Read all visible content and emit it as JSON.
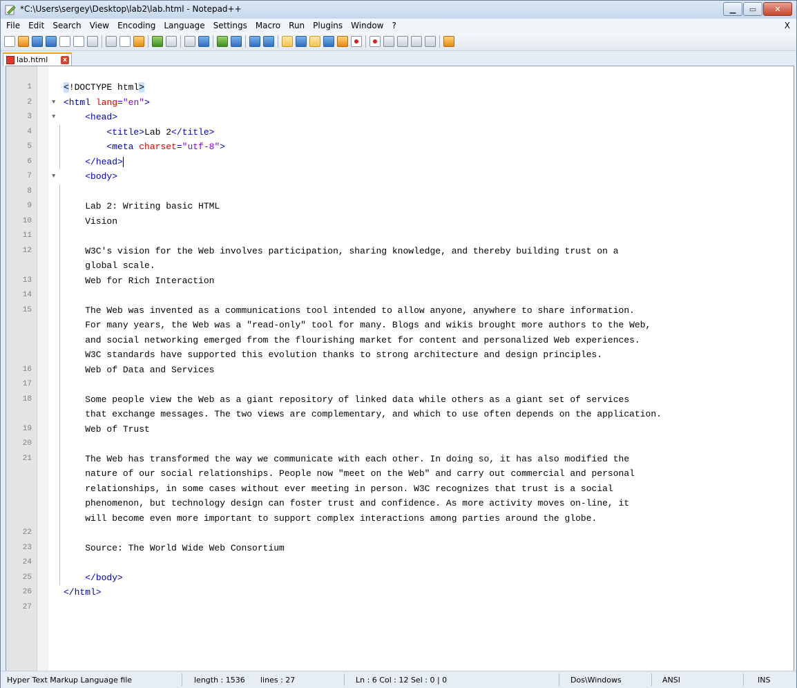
{
  "window": {
    "title": "*C:\\Users\\sergey\\Desktop\\lab2\\lab.html - Notepad++"
  },
  "menu": {
    "items": [
      "File",
      "Edit",
      "Search",
      "View",
      "Encoding",
      "Language",
      "Settings",
      "Macro",
      "Run",
      "Plugins",
      "Window",
      "?"
    ],
    "close_label": "X"
  },
  "tab": {
    "label": "lab.html",
    "close_label": "x"
  },
  "editor": {
    "lines": [
      {
        "n": "1",
        "fold": "",
        "bar": false,
        "segs": [
          [
            "hlb",
            "<"
          ],
          [
            "",
            "!DOCTYPE html"
          ],
          [
            "hlb",
            ">"
          ]
        ]
      },
      {
        "n": "2",
        "fold": "▼",
        "bar": false,
        "segs": [
          [
            "tag",
            "<html "
          ],
          [
            "attr",
            "lang"
          ],
          [
            "tag",
            "="
          ],
          [
            "val",
            "\"en\""
          ],
          [
            "tag",
            ">"
          ]
        ]
      },
      {
        "n": "3",
        "fold": "▼",
        "bar": false,
        "segs": [
          [
            "",
            "    "
          ],
          [
            "tag",
            "<head>"
          ]
        ]
      },
      {
        "n": "4",
        "fold": "",
        "bar": true,
        "segs": [
          [
            "",
            "        "
          ],
          [
            "tag",
            "<title>"
          ],
          [
            "",
            "Lab 2"
          ],
          [
            "tag",
            "</title>"
          ]
        ]
      },
      {
        "n": "5",
        "fold": "",
        "bar": true,
        "segs": [
          [
            "",
            "        "
          ],
          [
            "tag",
            "<meta "
          ],
          [
            "attr",
            "charset"
          ],
          [
            "tag",
            "="
          ],
          [
            "val",
            "\"utf-8\""
          ],
          [
            "tag",
            ">"
          ]
        ]
      },
      {
        "n": "6",
        "fold": "",
        "bar": true,
        "caret": true,
        "segs": [
          [
            "",
            "    "
          ],
          [
            "tag",
            "</head>"
          ]
        ]
      },
      {
        "n": "7",
        "fold": "▼",
        "bar": false,
        "segs": [
          [
            "",
            "    "
          ],
          [
            "tag",
            "<body>"
          ]
        ]
      },
      {
        "n": "8",
        "fold": "",
        "bar": true,
        "segs": []
      },
      {
        "n": "9",
        "fold": "",
        "bar": true,
        "segs": [
          [
            "",
            "    Lab 2: Writing basic HTML"
          ]
        ]
      },
      {
        "n": "10",
        "fold": "",
        "bar": true,
        "segs": [
          [
            "",
            "    Vision"
          ]
        ]
      },
      {
        "n": "11",
        "fold": "",
        "bar": true,
        "segs": []
      },
      {
        "n": "12",
        "fold": "",
        "bar": true,
        "segs": [
          [
            "",
            "    W3C's vision for the Web involves participation, sharing knowledge, and thereby building trust on a\n    global scale."
          ]
        ]
      },
      {
        "n": "13",
        "fold": "",
        "bar": true,
        "segs": [
          [
            "",
            "    Web for Rich Interaction"
          ]
        ]
      },
      {
        "n": "14",
        "fold": "",
        "bar": true,
        "segs": []
      },
      {
        "n": "15",
        "fold": "",
        "bar": true,
        "segs": [
          [
            "",
            "    The Web was invented as a communications tool intended to allow anyone, anywhere to share information.\n    For many years, the Web was a \"read-only\" tool for many. Blogs and wikis brought more authors to the Web,\n    and social networking emerged from the flourishing market for content and personalized Web experiences.\n    W3C standards have supported this evolution thanks to strong architecture and design principles."
          ]
        ]
      },
      {
        "n": "16",
        "fold": "",
        "bar": true,
        "segs": [
          [
            "",
            "    Web of Data and Services"
          ]
        ]
      },
      {
        "n": "17",
        "fold": "",
        "bar": true,
        "segs": []
      },
      {
        "n": "18",
        "fold": "",
        "bar": true,
        "segs": [
          [
            "",
            "    Some people view the Web as a giant repository of linked data while others as a giant set of services\n    that exchange messages. The two views are complementary, and which to use often depends on the application."
          ]
        ]
      },
      {
        "n": "19",
        "fold": "",
        "bar": true,
        "segs": [
          [
            "",
            "    Web of Trust"
          ]
        ]
      },
      {
        "n": "20",
        "fold": "",
        "bar": true,
        "segs": []
      },
      {
        "n": "21",
        "fold": "",
        "bar": true,
        "segs": [
          [
            "",
            "    The Web has transformed the way we communicate with each other. In doing so, it has also modified the\n    nature of our social relationships. People now \"meet on the Web\" and carry out commercial and personal\n    relationships, in some cases without ever meeting in person. W3C recognizes that trust is a social\n    phenomenon, but technology design can foster trust and confidence. As more activity moves on-line, it\n    will become even more important to support complex interactions among parties around the globe."
          ]
        ]
      },
      {
        "n": "22",
        "fold": "",
        "bar": true,
        "segs": []
      },
      {
        "n": "23",
        "fold": "",
        "bar": true,
        "segs": [
          [
            "",
            "    Source: The World Wide Web Consortium"
          ]
        ]
      },
      {
        "n": "24",
        "fold": "",
        "bar": true,
        "segs": []
      },
      {
        "n": "25",
        "fold": "",
        "bar": true,
        "segs": [
          [
            "",
            "    "
          ],
          [
            "tag",
            "</body>"
          ]
        ]
      },
      {
        "n": "26",
        "fold": "",
        "bar": false,
        "segs": [
          [
            "tag",
            "</html>"
          ]
        ]
      },
      {
        "n": "27",
        "fold": "",
        "bar": false,
        "segs": []
      }
    ]
  },
  "status": {
    "file_type": "Hyper Text Markup Language file",
    "length": "length : 1536",
    "lines": "lines : 27",
    "position": "Ln : 6    Col : 12    Sel : 0 | 0",
    "eol": "Dos\\Windows",
    "encoding": "ANSI",
    "mode": "INS"
  },
  "toolbar_icons": [
    [
      "new-file-icon",
      "doc"
    ],
    [
      "open-file-icon",
      "orange"
    ],
    [
      "save-icon",
      "blue"
    ],
    [
      "save-all-icon",
      "blue"
    ],
    [
      "close-icon",
      "doc"
    ],
    [
      "close-all-icon",
      "doc"
    ],
    [
      "print-icon",
      "gray"
    ],
    [
      "sep",
      ""
    ],
    [
      "cut-icon",
      "gray"
    ],
    [
      "copy-icon",
      "doc"
    ],
    [
      "paste-icon",
      "orange"
    ],
    [
      "sep",
      ""
    ],
    [
      "undo-icon",
      "green"
    ],
    [
      "redo-icon",
      "gray"
    ],
    [
      "sep",
      ""
    ],
    [
      "find-icon",
      "gray"
    ],
    [
      "replace-icon",
      "blue"
    ],
    [
      "sep",
      ""
    ],
    [
      "zoom-in-icon",
      "green"
    ],
    [
      "zoom-out-icon",
      "blue"
    ],
    [
      "sep",
      ""
    ],
    [
      "sync-vertical-icon",
      "blue"
    ],
    [
      "sync-horizontal-icon",
      "blue"
    ],
    [
      "sep",
      ""
    ],
    [
      "word-wrap-icon",
      "sel"
    ],
    [
      "show-all-chars-icon",
      "blue"
    ],
    [
      "indent-guide-icon",
      "sel"
    ],
    [
      "user-lang-icon",
      "blue"
    ],
    [
      "doc-map-icon",
      "orange"
    ],
    [
      "function-list-icon",
      "red"
    ],
    [
      "sep",
      ""
    ],
    [
      "record-macro-icon",
      "red"
    ],
    [
      "stop-record-icon",
      "gray"
    ],
    [
      "playback-icon",
      "gray"
    ],
    [
      "run-macro-icon",
      "gray"
    ],
    [
      "save-macro-icon",
      "gray"
    ],
    [
      "sep",
      ""
    ],
    [
      "launch-browser-icon",
      "orange"
    ]
  ]
}
